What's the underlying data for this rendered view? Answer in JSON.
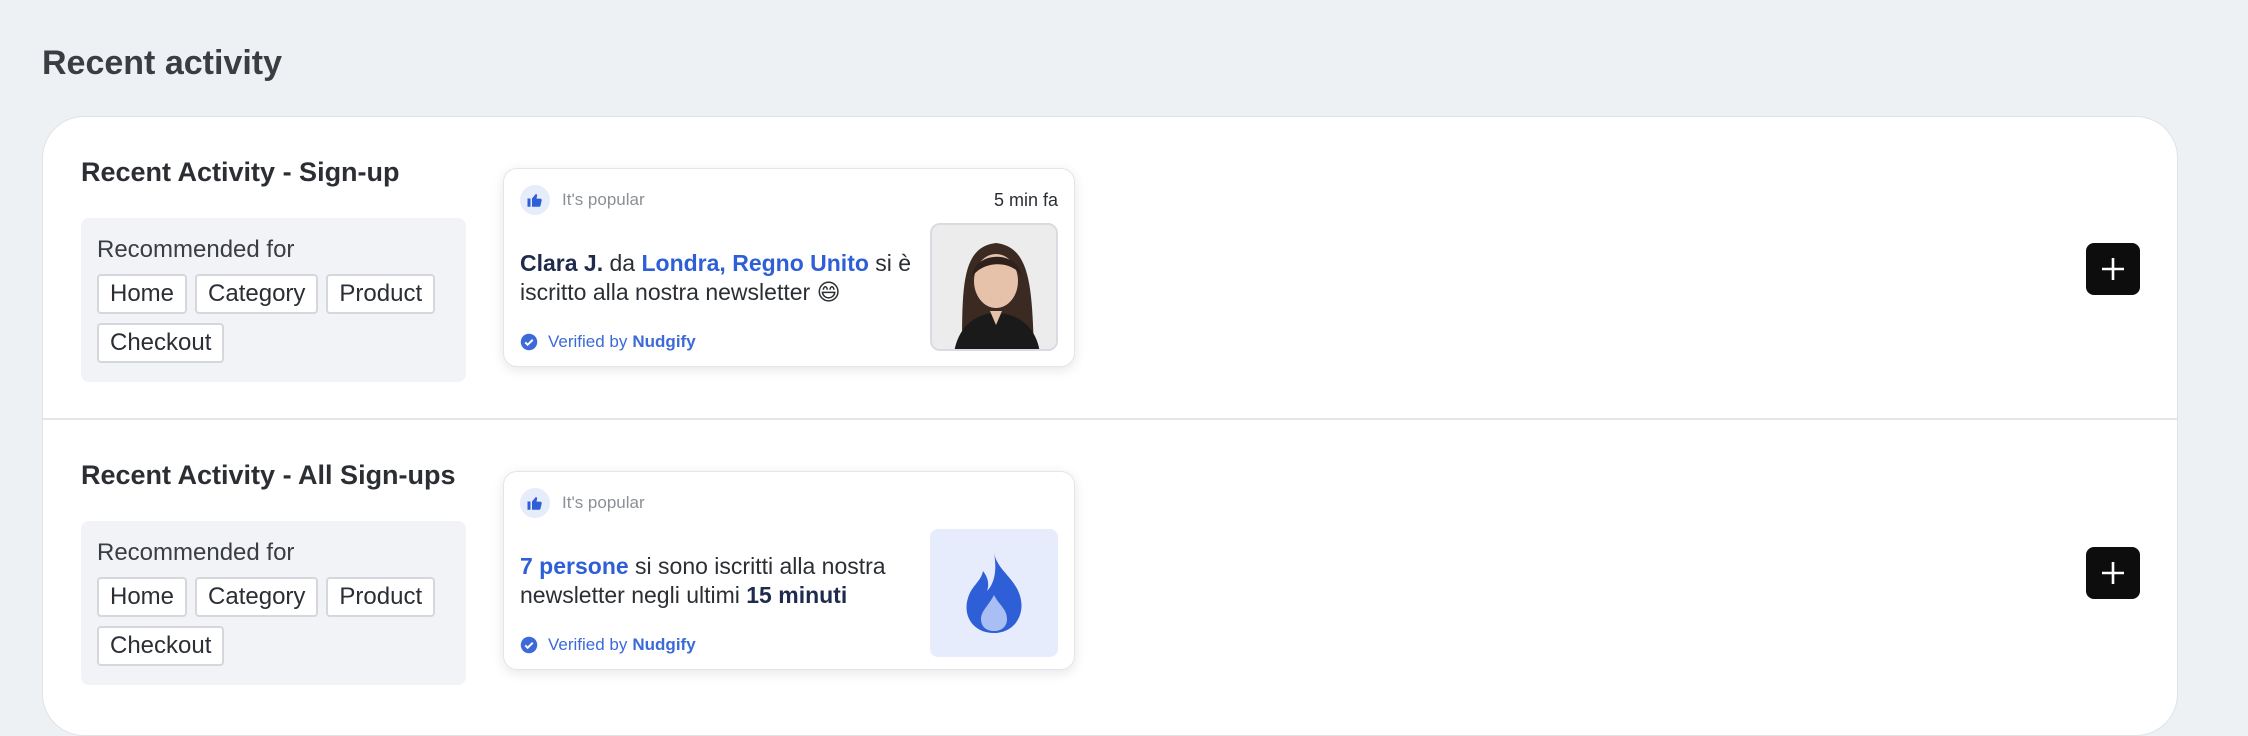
{
  "page": {
    "title": "Recent activity"
  },
  "rows": [
    {
      "title": "Recent Activity - Sign-up",
      "recommended_label": "Recommended for",
      "tags": [
        "Home",
        "Category",
        "Product",
        "Checkout"
      ],
      "notification": {
        "badge": "It's popular",
        "time": "5 min fa",
        "name": "Clara J.",
        "from": "da",
        "location": "Londra, Regno Unito",
        "message": "si è iscritto alla nostra newsletter 😄",
        "verified_prefix": "Verified by",
        "verified_brand": "Nudgify",
        "image": "person-avatar"
      }
    },
    {
      "title": "Recent Activity - All Sign-ups",
      "recommended_label": "Recommended for",
      "tags": [
        "Home",
        "Category",
        "Product",
        "Checkout"
      ],
      "notification": {
        "badge": "It's popular",
        "count": "7 persone",
        "message": "si sono iscritti alla nostra newsletter negli ultimi",
        "period": "15 minuti",
        "verified_prefix": "Verified by",
        "verified_brand": "Nudgify",
        "image": "fire-icon"
      }
    }
  ],
  "colors": {
    "accent": "#2f5fd6",
    "button": "#0d0d0d",
    "background": "#eef1f4"
  }
}
